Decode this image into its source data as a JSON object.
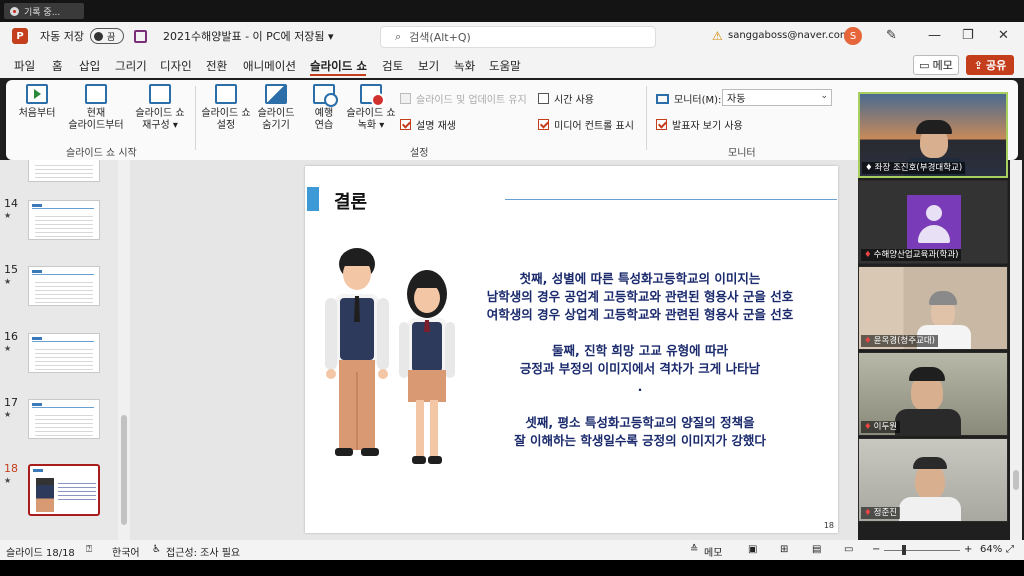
{
  "recording": {
    "label": "기록 중..."
  },
  "titlebar": {
    "autosave_label": "자동 저장",
    "autosave_state": "끔",
    "doc_title": "2021수해양발표 - 이 PC에 저장됨 ▾",
    "search_placeholder": "검색(Alt+Q)",
    "account_email": "sanggaboss@naver.com",
    "avatar_initial": "S"
  },
  "tabs": [
    "파일",
    "홈",
    "삽입",
    "그리기",
    "디자인",
    "전환",
    "애니메이션",
    "슬라이드 쇼",
    "검토",
    "보기",
    "녹화",
    "도움말"
  ],
  "active_tab": "슬라이드 쇼",
  "header_buttons": {
    "memo": "메모",
    "share": "공유"
  },
  "ribbon": {
    "start_group": "슬라이드 쇼 시작",
    "setup_group": "설정",
    "monitor_group": "모니터",
    "btn_from_start": "처음부터",
    "btn_current": "현재\n슬라이드부터",
    "btn_custom": "슬라이드 쇼\n재구성 ▾",
    "btn_setup": "슬라이드 쇼\n설정",
    "btn_hide": "슬라이드\n숨기기",
    "btn_rehearse": "예행\n연습",
    "btn_record": "슬라이드 쇼\n녹화 ▾",
    "cb_update": "슬라이드 및 업데이트 유지",
    "cb_narration": "설명 재생",
    "cb_timing": "시간 사용",
    "cb_media": "미디어 컨트롤 표시",
    "monitor_label": "모니터(M):",
    "monitor_value": "자동",
    "cb_presenter": "발표자 보기 사용"
  },
  "thumbnails": [
    {
      "num": "14",
      "star": "★"
    },
    {
      "num": "15",
      "star": "★"
    },
    {
      "num": "16",
      "star": "★"
    },
    {
      "num": "17",
      "star": "★"
    },
    {
      "num": "18",
      "star": "★"
    }
  ],
  "slide": {
    "title": "결론",
    "lines": [
      "첫째, 성별에 따른 특성화고등학교의 이미지는",
      "남학생의 경우 공업계 고등학교와 관련된 형용사 군을 선호",
      "여학생의 경우 상업계 고등학교와 관련된 형용사 군을 선호",
      "",
      "둘째, 진학 희망 고교 유형에 따라",
      "긍정과 부정의 이미지에서 격차가 크게 나타남",
      ".",
      "",
      "셋째, 평소 특성화고등학교의 양질의 정책을",
      "잘 이해하는 학생일수록 긍정의 이미지가 강했다"
    ],
    "page_number": "18"
  },
  "participants": [
    "좌장 조진호(부경대학교)",
    "수해양산업교육과(학과)",
    "윤옥경(청주교대)",
    "이두원",
    "정준진"
  ],
  "status": {
    "slide_info": "슬라이드 18/18",
    "language": "한국어",
    "accessibility": "접근성: 조사 필요",
    "notes": "메모",
    "zoom": "64%"
  },
  "colors": {
    "accent": "#c43e1c",
    "slide_text": "#1a2a6c",
    "title_bar": "#3e9ad6"
  }
}
